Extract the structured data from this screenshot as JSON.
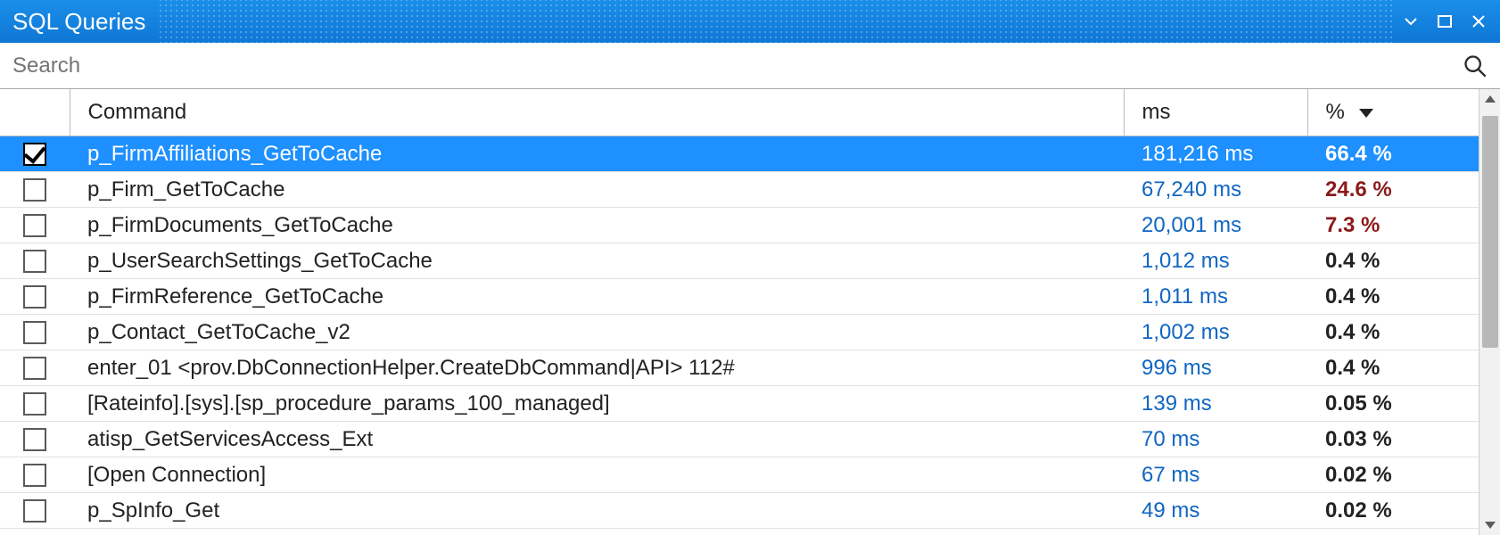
{
  "window": {
    "title": "SQL Queries"
  },
  "search": {
    "placeholder": "Search",
    "value": ""
  },
  "columns": {
    "command": "Command",
    "ms": "ms",
    "percent": "%",
    "sort": {
      "column": "percent",
      "direction": "desc"
    }
  },
  "rows": [
    {
      "checked": true,
      "selected": true,
      "command": "p_FirmAffiliations_GetToCache",
      "ms": "181,216 ms",
      "percent": "66.4 %",
      "pct_high": false
    },
    {
      "checked": false,
      "selected": false,
      "command": "p_Firm_GetToCache",
      "ms": "67,240 ms",
      "percent": "24.6 %",
      "pct_high": true
    },
    {
      "checked": false,
      "selected": false,
      "command": "p_FirmDocuments_GetToCache",
      "ms": "20,001 ms",
      "percent": "7.3 %",
      "pct_high": true
    },
    {
      "checked": false,
      "selected": false,
      "command": "p_UserSearchSettings_GetToCache",
      "ms": "1,012 ms",
      "percent": "0.4 %",
      "pct_high": false
    },
    {
      "checked": false,
      "selected": false,
      "command": "p_FirmReference_GetToCache",
      "ms": "1,011 ms",
      "percent": "0.4 %",
      "pct_high": false
    },
    {
      "checked": false,
      "selected": false,
      "command": "p_Contact_GetToCache_v2",
      "ms": "1,002 ms",
      "percent": "0.4 %",
      "pct_high": false
    },
    {
      "checked": false,
      "selected": false,
      "command": "enter_01 <prov.DbConnectionHelper.CreateDbCommand|API> 112#",
      "ms": "996 ms",
      "percent": "0.4 %",
      "pct_high": false
    },
    {
      "checked": false,
      "selected": false,
      "command": "[Rateinfo].[sys].[sp_procedure_params_100_managed]",
      "ms": "139 ms",
      "percent": "0.05 %",
      "pct_high": false
    },
    {
      "checked": false,
      "selected": false,
      "command": "atisp_GetServicesAccess_Ext",
      "ms": "70 ms",
      "percent": "0.03 %",
      "pct_high": false
    },
    {
      "checked": false,
      "selected": false,
      "command": "[Open Connection]",
      "ms": "67 ms",
      "percent": "0.02 %",
      "pct_high": false
    },
    {
      "checked": false,
      "selected": false,
      "command": "p_SpInfo_Get",
      "ms": "49 ms",
      "percent": "0.02 %",
      "pct_high": false
    }
  ]
}
